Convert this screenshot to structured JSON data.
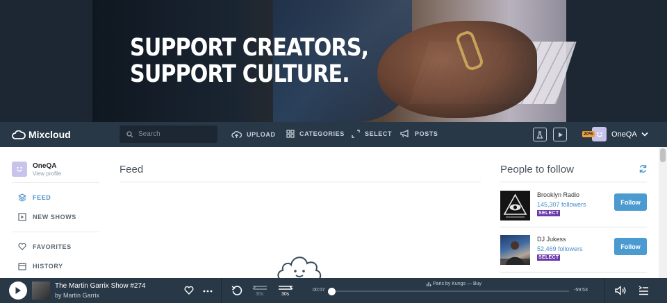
{
  "hero": {
    "headline_line1": "SUPPORT CREATORS,",
    "headline_line2": "SUPPORT CULTURE."
  },
  "nav": {
    "logo_text": "Mixcloud",
    "search_placeholder": "Search",
    "items": [
      {
        "label": "UPLOAD",
        "icon": "upload-cloud-icon"
      },
      {
        "label": "CATEGORIES",
        "icon": "grid-icon"
      },
      {
        "label": "SELECT",
        "icon": "select-brackets-icon"
      },
      {
        "label": "POSTS",
        "icon": "megaphone-icon"
      }
    ],
    "discount_badge": "20%",
    "username": "OneQA"
  },
  "sidebar": {
    "profile_name": "OneQA",
    "profile_link": "View profile",
    "items": [
      {
        "label": "FEED",
        "icon": "layers-icon",
        "active": true
      },
      {
        "label": "NEW SHOWS",
        "icon": "play-square-icon",
        "active": false
      },
      {
        "label": "FAVORITES",
        "icon": "heart-icon",
        "active": false
      },
      {
        "label": "HISTORY",
        "icon": "calendar-icon",
        "active": false
      }
    ]
  },
  "feed": {
    "title": "Feed"
  },
  "people_to_follow": {
    "title": "People to follow",
    "people": [
      {
        "name": "Brooklyn Radio",
        "followers": "145,307 followers",
        "badge": "SELECT",
        "button": "Follow"
      },
      {
        "name": "DJ Jukess",
        "followers": "52,469 followers",
        "badge": "SELECT",
        "button": "Follow"
      }
    ]
  },
  "player": {
    "track_title": "The Martin Garrix Show #274",
    "track_artist": "by Martin Garrix",
    "rewind_label": "30s",
    "forward_label": "30s",
    "elapsed": "00:07",
    "remaining": "-59:53",
    "now_playing": "Paris by Kungs — Buy",
    "progress_fraction": 0.002
  },
  "colors": {
    "nav_bg": "#293847",
    "accent_blue": "#4b9bd1",
    "select_purple": "#6a3aa8",
    "discount_orange": "#f2a33a"
  }
}
